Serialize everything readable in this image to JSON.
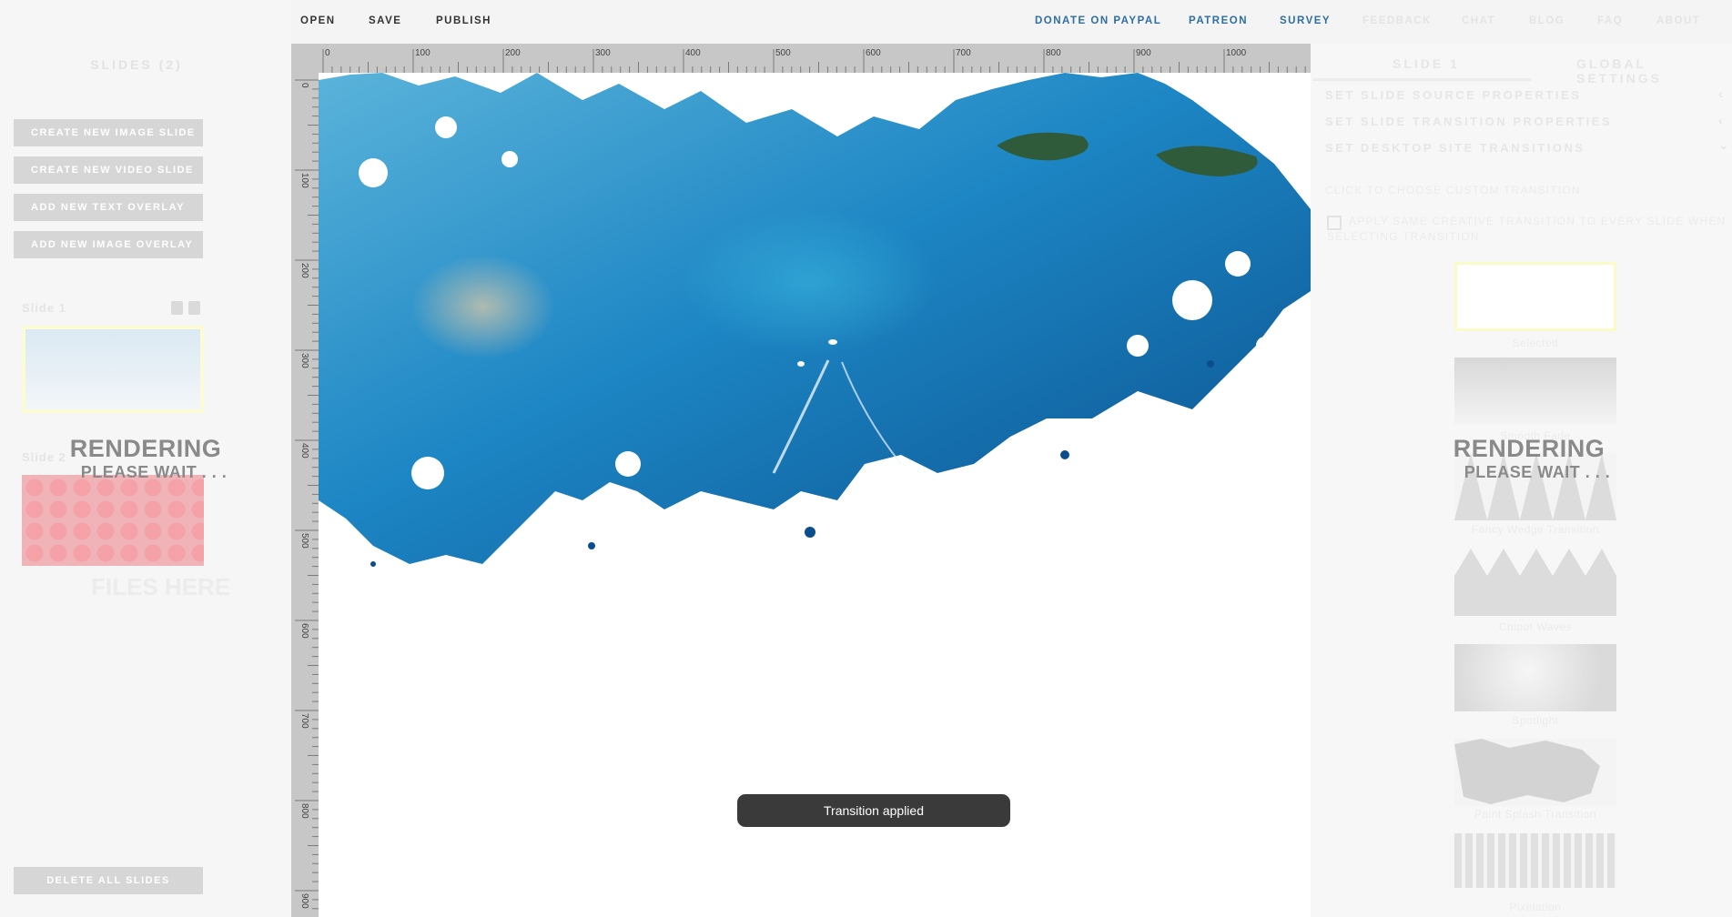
{
  "nav": {
    "open": "OPEN",
    "save": "SAVE",
    "publish": "PUBLISH",
    "donate": "DONATE ON PAYPAL",
    "patreon": "PATREON",
    "survey": "SURVEY",
    "feedback": "FEEDBACK",
    "chat": "CHAT",
    "blog": "BLOG",
    "faq": "FAQ",
    "about": "ABOUT"
  },
  "sidebar": {
    "title": "SLIDES (2)",
    "buttons": {
      "create_image_slide": "CREATE NEW IMAGE SLIDE",
      "create_video_slide": "CREATE NEW VIDEO SLIDE",
      "add_text_overlay": "ADD NEW TEXT OVERLAY",
      "add_image_overlay": "ADD NEW IMAGE OVERLAY",
      "delete_all": "DELETE ALL SLIDES"
    },
    "slides": [
      {
        "label": "Slide 1"
      },
      {
        "label": "Slide 2"
      }
    ],
    "drop_hint": "FILES HERE"
  },
  "rendering": {
    "title": "RENDERING",
    "subtitle": "PLEASE WAIT . . ."
  },
  "ruler": {
    "horizontal": [
      "0",
      "100",
      "200",
      "300",
      "400",
      "500",
      "600",
      "700",
      "800",
      "900",
      "1000"
    ],
    "vertical": [
      "0",
      "100",
      "200",
      "300",
      "400",
      "500",
      "600",
      "700",
      "800",
      "900"
    ]
  },
  "right_panel": {
    "tabs": [
      "SLIDE 1",
      "GLOBAL SETTINGS"
    ],
    "sections": [
      {
        "label": "SET SLIDE SOURCE PROPERTIES",
        "chevron": "‹"
      },
      {
        "label": "SET SLIDE TRANSITION PROPERTIES",
        "chevron": "‹"
      },
      {
        "label": "SET DESKTOP SITE TRANSITIONS",
        "chevron": "⌄"
      }
    ],
    "hint": "CLICK TO CHOOSE CUSTOM TRANSITION",
    "checkbox_label_line1": "APPLY SAME CREATIVE TRANSITION TO EVERY SLIDE WHEN",
    "checkbox_label_line2": "SELECTING TRANSITION",
    "transitions": [
      "Selected",
      "Smooth Fade",
      "Fancy Wedge Transition",
      "Chipot Waves",
      "Spotlight",
      "Paint Splash Transition",
      "Pixelation"
    ]
  },
  "toast": "Transition applied",
  "colors": {
    "nav_blue": "#2f6ea3",
    "toast_bg": "#3a3a3a",
    "ruler_bg": "#c7c7c7",
    "water_deep": "#0b5fa0",
    "water_light": "#3aa6d6"
  }
}
